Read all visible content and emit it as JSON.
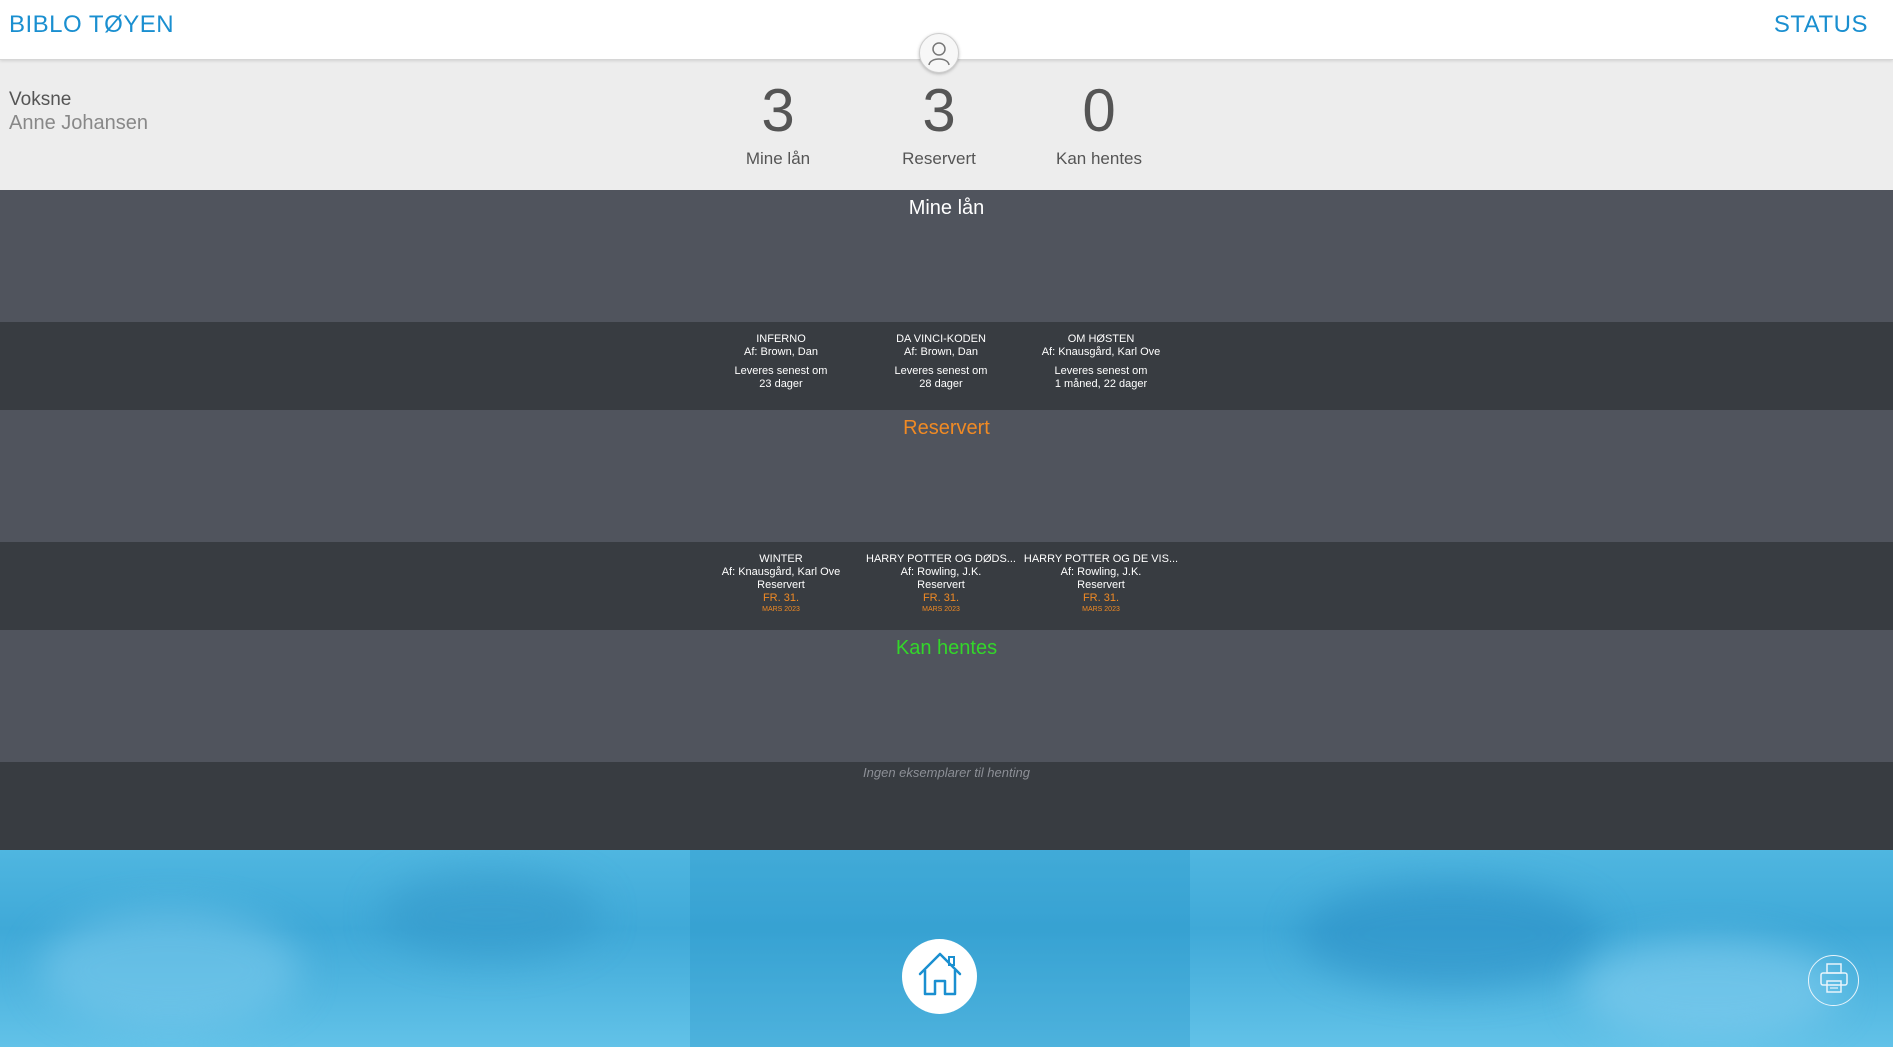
{
  "header": {
    "brand": "BIBLO TØYEN",
    "status_link": "STATUS",
    "avatar_icon": "user-icon"
  },
  "user": {
    "category": "Voksne",
    "name": "Anne Johansen"
  },
  "stats": [
    {
      "value": "3",
      "label": "Mine lån"
    },
    {
      "value": "3",
      "label": "Reservert"
    },
    {
      "value": "0",
      "label": "Kan hentes"
    }
  ],
  "sections": {
    "loans": {
      "title": "Mine lån",
      "title_color": "#ffffff",
      "items": [
        {
          "title": "INFERNO",
          "author": "Af: Brown, Dan",
          "due_line1": "Leveres senest om",
          "due_line2": "23 dager"
        },
        {
          "title": "DA VINCI-KODEN",
          "author": "Af: Brown, Dan",
          "due_line1": "Leveres senest om",
          "due_line2": "28 dager"
        },
        {
          "title": "OM HØSTEN",
          "author": "Af: Knausgård, Karl Ove",
          "due_line1": "Leveres senest om",
          "due_line2": "1 måned, 22 dager"
        }
      ]
    },
    "reserved": {
      "title": "Reservert",
      "title_color": "#f08a24",
      "items": [
        {
          "title": "WINTER",
          "author": "Af: Knausgård, Karl Ove",
          "status": "Reservert",
          "date": "FR. 31.",
          "date_small": "MARS 2023"
        },
        {
          "title": "HARRY POTTER OG DØDS...",
          "author": "Af: Rowling, J.K.",
          "status": "Reservert",
          "date": "FR. 31.",
          "date_small": "MARS 2023"
        },
        {
          "title": "HARRY POTTER OG DE VIS...",
          "author": "Af: Rowling, J.K.",
          "status": "Reservert",
          "date": "FR. 31.",
          "date_small": "MARS 2023"
        }
      ]
    },
    "pickup": {
      "title": "Kan hentes",
      "title_color": "#33d62a",
      "empty_text": "Ingen eksemplarer til henting"
    }
  },
  "footer": {
    "home_icon": "home-icon",
    "print_icon": "printer-icon"
  }
}
